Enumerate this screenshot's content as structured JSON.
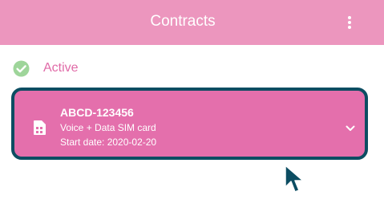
{
  "header": {
    "title": "Contracts",
    "menu_icon": "more-vertical-icon",
    "background": "#ec96be"
  },
  "section": {
    "label": "Active",
    "status_icon": "check-circle-icon",
    "status_color": "#9ed59a"
  },
  "contract": {
    "id": "ABCD-123456",
    "type": "Voice + Data SIM card",
    "start_date": "Start date: 2020-02-20",
    "icon": "sim-card-icon",
    "expand_icon": "chevron-down-icon",
    "card_color": "#e46fac",
    "highlight_color": "#0c4d62"
  },
  "pointer": {
    "icon": "mouse-pointer-icon"
  }
}
